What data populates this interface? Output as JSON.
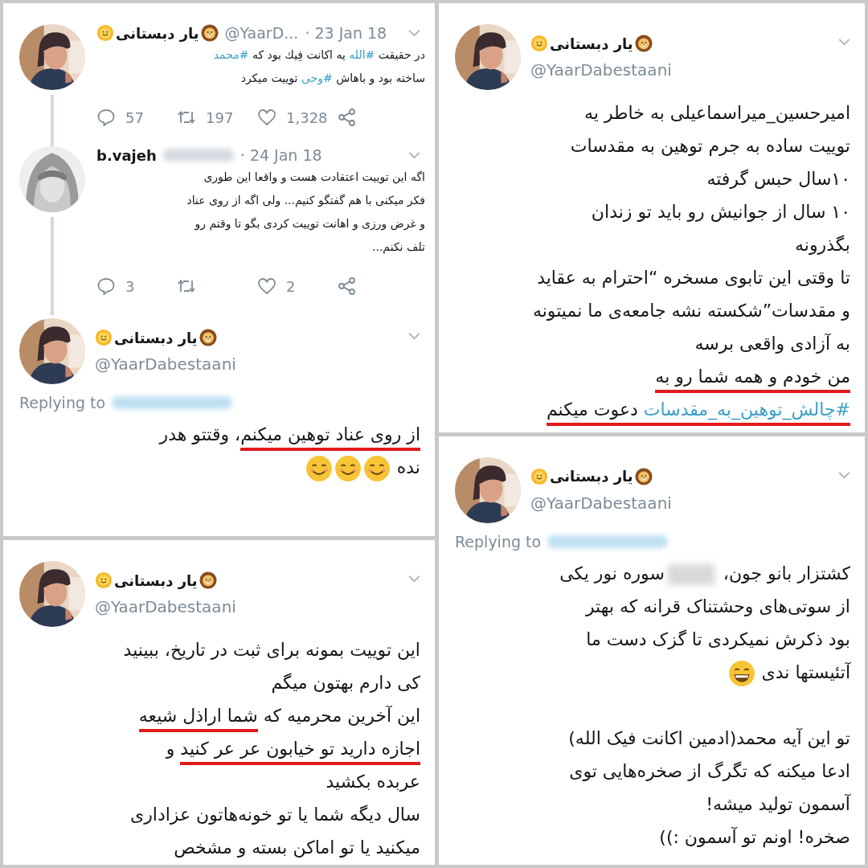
{
  "columns": [
    {
      "panels": [
        {
          "tweets": [
            {
              "kind": "expanded",
              "emoji_badges": true,
              "name": "یار دبستانی",
              "handle": "@YaarDabestaani",
              "lines": [
                {
                  "segments": [
                    {
                      "kind": "text",
                      "text": "امیرحسین_میراسماعیلی به خاطر یه"
                    }
                  ]
                },
                {
                  "segments": [
                    {
                      "kind": "text",
                      "text": "توییت ساده به جرم توهین به مقدسات"
                    }
                  ]
                },
                {
                  "segments": [
                    {
                      "kind": "text",
                      "text": "۱۰سال حبس گرفته"
                    }
                  ]
                },
                {
                  "segments": [
                    {
                      "kind": "text",
                      "text": "۱۰ سال از جوانیش رو باید تو زندان"
                    }
                  ]
                },
                {
                  "segments": [
                    {
                      "kind": "text",
                      "text": "بگذرونه"
                    }
                  ]
                },
                {
                  "segments": [
                    {
                      "kind": "text",
                      "text": "تا وقتی این تابوی مسخره “احترام به عقاید"
                    }
                  ]
                },
                {
                  "segments": [
                    {
                      "kind": "text",
                      "text": "و مقدسات”شکسته نشه جامعه‌ی ما نمیتونه"
                    }
                  ]
                },
                {
                  "segments": [
                    {
                      "kind": "text",
                      "text": "به آزادی واقعی برسه"
                    }
                  ]
                },
                {
                  "segments": [
                    {
                      "kind": "text",
                      "text": "من خودم و همه شما رو به",
                      "underlined": true
                    }
                  ]
                },
                {
                  "segments": [
                    {
                      "kind": "hashtag",
                      "text": "#چالش_توهین_به_مقدسات",
                      "underlined": true
                    },
                    {
                      "kind": "text",
                      "text": " دعوت میکنم",
                      "underlined": true
                    }
                  ]
                }
              ]
            }
          ]
        },
        {
          "tweets": [
            {
              "kind": "expanded",
              "emoji_badges": true,
              "name": "یار دبستانی",
              "handle": "@YaarDabestaani",
              "replying_to": "Replying to",
              "lines": [
                {
                  "segments": [
                    {
                      "kind": "text",
                      "text": "کشتزار بانو جون، "
                    },
                    {
                      "kind": "blur"
                    },
                    {
                      "kind": "text",
                      "text": "سوره نور یکی"
                    }
                  ]
                },
                {
                  "segments": [
                    {
                      "kind": "text",
                      "text": "از سوتی‌های وحشتناک قرانه که بهتر"
                    }
                  ]
                },
                {
                  "segments": [
                    {
                      "kind": "text",
                      "text": "بود ذکرش نمیکردی تا گزک دست ما"
                    }
                  ]
                },
                {
                  "segments": [
                    {
                      "kind": "text",
                      "text": "آتئیستها ندی "
                    },
                    {
                      "kind": "grin"
                    }
                  ]
                },
                {
                  "kind": "blank"
                },
                {
                  "segments": [
                    {
                      "kind": "text",
                      "text": "تو این آیه محمد(ادمین اکانت فیک الله)"
                    }
                  ]
                },
                {
                  "segments": [
                    {
                      "kind": "text",
                      "text": "ادعا میکنه که تگرگ از صخره‌هایی توی"
                    }
                  ]
                },
                {
                  "segments": [
                    {
                      "kind": "text",
                      "text": "آسمون تولید میشه!"
                    }
                  ]
                },
                {
                  "segments": [
                    {
                      "kind": "text",
                      "text": "صخره! اونم تو آسمون :))"
                    }
                  ]
                }
              ]
            }
          ]
        }
      ]
    },
    {
      "panels": [
        {
          "tweets": [
            {
              "kind": "compact",
              "threaded": true,
              "emoji_badges": true,
              "name": "یار دبستانی",
              "handle": "@YaarD...",
              "handle_blurred": false,
              "date": "· 23 Jan 18",
              "lines": [
                {
                  "segments": [
                    {
                      "kind": "text",
                      "text": "در حقیقت "
                    },
                    {
                      "kind": "hashtag",
                      "text": "#الله"
                    },
                    {
                      "kind": "text",
                      "text": " یه اکانت فِیك بود که "
                    },
                    {
                      "kind": "hashtag",
                      "text": "#محمد"
                    }
                  ]
                },
                {
                  "segments": [
                    {
                      "kind": "text",
                      "text": "ساخته بود و باهاش "
                    },
                    {
                      "kind": "hashtag",
                      "text": "#وحی"
                    },
                    {
                      "kind": "text",
                      "text": " توییت میکرد"
                    }
                  ]
                }
              ],
              "actions": {
                "replies": "57",
                "retweets": "197",
                "likes": "1,328"
              }
            },
            {
              "kind": "compact",
              "threaded": true,
              "emoji_badges": false,
              "name": "b.vajeh",
              "handle_blurred": true,
              "date": "· 24 Jan 18",
              "lines": [
                {
                  "segments": [
                    {
                      "kind": "text",
                      "text": "اگه این توییت اعتقادت هست و واقعا این طوری"
                    }
                  ]
                },
                {
                  "segments": [
                    {
                      "kind": "text",
                      "text": "فکر میکنی با هم گفتگو کنیم... ولی اگه از روی عناد"
                    }
                  ]
                },
                {
                  "segments": [
                    {
                      "kind": "text",
                      "text": "و غرض ورزی و اهانت توییت کردی  بگو تا وقتم رو"
                    }
                  ]
                },
                {
                  "segments": [
                    {
                      "kind": "text",
                      "text": "تلف نکنم..."
                    }
                  ]
                }
              ],
              "actions": {
                "replies": "3",
                "likes": "2"
              }
            },
            {
              "kind": "expanded",
              "emoji_badges": true,
              "name": "یار دبستانی",
              "handle": "@YaarDabestaani",
              "replying_to": "Replying to",
              "lines": [
                {
                  "segments": [
                    {
                      "kind": "text",
                      "text": "از روی عناد توهین میکنم",
                      "underlined": true
                    },
                    {
                      "kind": "text",
                      "text": "، وقتتو هدر"
                    }
                  ]
                },
                {
                  "segments": [
                    {
                      "kind": "text",
                      "text": "نده "
                    },
                    {
                      "kind": "smile"
                    },
                    {
                      "kind": "smile"
                    },
                    {
                      "kind": "smile"
                    }
                  ]
                }
              ]
            }
          ]
        },
        {
          "tweets": [
            {
              "kind": "expanded",
              "emoji_badges": true,
              "name": "یار دبستانی",
              "handle": "@YaarDabestaani",
              "lines": [
                {
                  "segments": [
                    {
                      "kind": "text",
                      "text": "این توییت بمونه برای ثبت در تاریخ، ببینید"
                    }
                  ]
                },
                {
                  "segments": [
                    {
                      "kind": "text",
                      "text": "کی دارم بهتون میگم"
                    }
                  ]
                },
                {
                  "segments": [
                    {
                      "kind": "text",
                      "text": "این آخرین محرمیه که "
                    },
                    {
                      "kind": "text",
                      "text": "شما اراذل شیعه",
                      "underlined": true
                    }
                  ]
                },
                {
                  "segments": [
                    {
                      "kind": "text",
                      "text": "اجازه دارید تو خیابون عر عر کنید",
                      "underlined": true
                    },
                    {
                      "kind": "text",
                      "text": " و"
                    }
                  ]
                },
                {
                  "segments": [
                    {
                      "kind": "text",
                      "text": "عربده بکشید"
                    }
                  ]
                },
                {
                  "segments": [
                    {
                      "kind": "text",
                      "text": "سال دیگه شما یا تو خونه‌هاتون عزاداری"
                    }
                  ]
                },
                {
                  "segments": [
                    {
                      "kind": "text",
                      "text": "میکنید یا تو اماکن بسته و مشخص"
                    }
                  ]
                }
              ]
            }
          ]
        }
      ]
    }
  ]
}
